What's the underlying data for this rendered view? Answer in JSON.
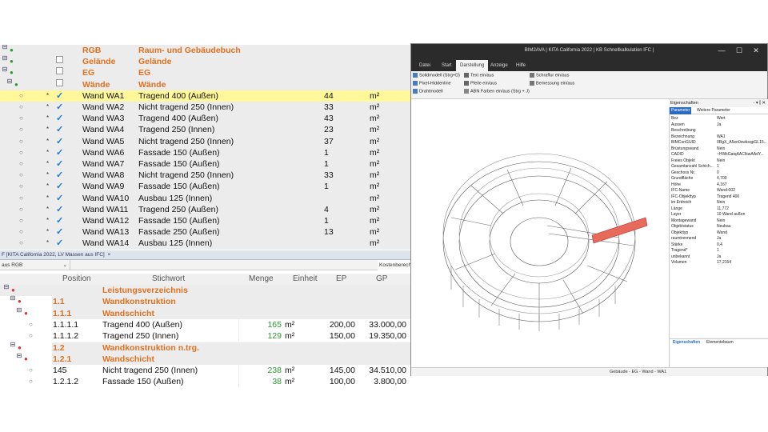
{
  "top_table": {
    "rows": [
      {
        "tree": "⊟",
        "dot": "●",
        "cb": "",
        "col1": "RGB",
        "col2": "Raum- und Gebäudebuch",
        "num": "",
        "unit": "",
        "style": "orange-gray"
      },
      {
        "tree": "⊟",
        "dot": "●",
        "cb": "□",
        "col1": "Gelände",
        "col2": "Gelände",
        "num": "",
        "unit": "",
        "style": "orange-gray"
      },
      {
        "tree": "⊟",
        "dot": "●",
        "cb": "□",
        "col1": "EG",
        "col2": "EG",
        "num": "",
        "unit": "",
        "style": "orange-gray"
      },
      {
        "tree": "⊟",
        "dot": "●",
        "cb": "□",
        "col1": "Wände",
        "col2": "Wände",
        "num": "",
        "unit": "",
        "style": "orange-gray"
      },
      {
        "dot": "○",
        "star": "*",
        "cb": "✓",
        "col1": "Wand WA1",
        "col2": "Tragend 400 (Außen)",
        "num": "44",
        "unit": "m²",
        "style": "yellow"
      },
      {
        "dot": "○",
        "star": "*",
        "cb": "✓",
        "col1": "Wand WA2",
        "col2": "Nicht tragend 250 (Innen)",
        "num": "33",
        "unit": "m²",
        "style": "gray"
      },
      {
        "dot": "○",
        "star": "*",
        "cb": "✓",
        "col1": "Wand WA3",
        "col2": "Tragend 400 (Außen)",
        "num": "43",
        "unit": "m²",
        "style": "gray"
      },
      {
        "dot": "○",
        "star": "*",
        "cb": "✓",
        "col1": "Wand WA4",
        "col2": "Tragend 250 (Innen)",
        "num": "23",
        "unit": "m²",
        "style": "gray"
      },
      {
        "dot": "○",
        "star": "*",
        "cb": "✓",
        "col1": "Wand WA5",
        "col2": "Nicht tragend 250 (Innen)",
        "num": "37",
        "unit": "m²",
        "style": "gray"
      },
      {
        "dot": "○",
        "star": "*",
        "cb": "✓",
        "col1": "Wand WA6",
        "col2": "Fassade 150 (Außen)",
        "num": "1",
        "unit": "m²",
        "style": "gray"
      },
      {
        "dot": "○",
        "star": "*",
        "cb": "✓",
        "col1": "Wand WA7",
        "col2": "Fassade 150 (Außen)",
        "num": "1",
        "unit": "m²",
        "style": "gray"
      },
      {
        "dot": "○",
        "star": "*",
        "cb": "✓",
        "col1": "Wand WA8",
        "col2": "Nicht tragend 250 (Innen)",
        "num": "33",
        "unit": "m²",
        "style": "gray"
      },
      {
        "dot": "○",
        "star": "*",
        "cb": "✓",
        "col1": "Wand WA9",
        "col2": "Fassade 150 (Außen)",
        "num": "1",
        "unit": "m²",
        "style": "gray"
      },
      {
        "dot": "○",
        "star": "*",
        "cb": "✓",
        "col1": "Wand WA10",
        "col2": "Ausbau 125 (Innen)",
        "num": "",
        "unit": "m²",
        "style": "gray"
      },
      {
        "dot": "○",
        "star": "*",
        "cb": "✓",
        "col1": "Wand WA11",
        "col2": "Tragend 250 (Außen)",
        "num": "4",
        "unit": "m²",
        "style": "gray"
      },
      {
        "dot": "○",
        "star": "*",
        "cb": "✓",
        "col1": "Wand WA12",
        "col2": "Fassade 150 (Außen)",
        "num": "1",
        "unit": "m²",
        "style": "gray"
      },
      {
        "dot": "○",
        "star": "*",
        "cb": "✓",
        "col1": "Wand WA13",
        "col2": "Fassade 250 (Außen)",
        "num": "13",
        "unit": "m²",
        "style": "gray"
      },
      {
        "dot": "○",
        "star": "*",
        "cb": "✓",
        "col1": "Wand WA14",
        "col2": "Ausbau 125 (Innen)",
        "num": "",
        "unit": "m²",
        "style": "gray"
      }
    ]
  },
  "mid_bar": {
    "title": "F [KITA California 2022, LV Massen aus IFC]",
    "close": "×"
  },
  "mid_bar2": {
    "select": "aus RGB",
    "right": "Kostenberechi"
  },
  "bottom_table": {
    "headers": {
      "position": "Position",
      "stichwort": "Stichwort",
      "menge": "Menge",
      "einheit": "Einheit",
      "ep": "EP",
      "gp": "GP"
    },
    "rows": [
      {
        "tree": "⊟",
        "dot": "●",
        "pos": "",
        "text": "Leistungsverzeichnis",
        "menge": "",
        "unit": "",
        "ep": "",
        "gp": "",
        "style": "orange-gray"
      },
      {
        "tree": "⊟",
        "dot": "●",
        "pos": "1.1",
        "text": "Wandkonstruktion",
        "menge": "",
        "unit": "",
        "ep": "",
        "gp": "",
        "style": "orange"
      },
      {
        "tree": "⊟",
        "dot": "●",
        "pos": "1.1.1",
        "text": "Wandschicht",
        "menge": "",
        "unit": "",
        "ep": "",
        "gp": "",
        "style": "orange"
      },
      {
        "dot": "○",
        "pos": "1.1.1.1",
        "text": "Tragend 400 (Außen)",
        "menge": "165",
        "unit": "m²",
        "ep": "200,00",
        "gp": "33.000,00",
        "style": "plain"
      },
      {
        "dot": "○",
        "pos": "1.1.1.2",
        "text": "Tragend 250 (Innen)",
        "menge": "129",
        "unit": "m²",
        "ep": "150,00",
        "gp": "19.350,00",
        "style": "plain"
      },
      {
        "tree": "⊟",
        "dot": "●",
        "pos": "1.2",
        "text": "Wandkonstruktion n.trg.",
        "menge": "",
        "unit": "",
        "ep": "",
        "gp": "",
        "style": "orange"
      },
      {
        "tree": "⊟",
        "dot": "●",
        "pos": "1.2.1",
        "text": "Wandschicht",
        "menge": "",
        "unit": "",
        "ep": "",
        "gp": "",
        "style": "orange"
      },
      {
        "dot": "○",
        "pos": "145",
        "text": "Nicht tragend 250 (Innen)",
        "menge": "238",
        "unit": "m²",
        "ep": "145,00",
        "gp": "34.510,00",
        "style": "plain"
      },
      {
        "dot": "○",
        "pos": "1.2.1.2",
        "text": "Fassade 150 (Außen)",
        "menge": "38",
        "unit": "m²",
        "ep": "100,00",
        "gp": "3.800,00",
        "style": "plain"
      }
    ]
  },
  "window": {
    "title": "BIM2AVA | KITA California 2022 |  KB Schnellkalkulation IFC |",
    "controls": {
      "min": "—",
      "max": "☐",
      "close": "✕"
    },
    "tabs": [
      "Datei",
      "Start",
      "Darstellung",
      "Anzeige",
      "Hilfe"
    ],
    "active_tab": "Darstellung",
    "ribbon": {
      "col1": [
        "Solidmodell (Strg+D)",
        "Pixel-Hiddenline",
        "Drahtmodell"
      ],
      "col2": [
        "Text ein/aus",
        "Pfeile ein/aus",
        "ABN Farben ein/aus (Strg + J)"
      ],
      "col3": [
        "Schraffur ein/aus",
        "Bemessung ein/aus"
      ]
    },
    "props": {
      "title": "Eigenschaften",
      "title_controls": "- ▾ ⫿ ✕",
      "tabs": [
        "Parameter",
        "Weitere Parameter"
      ],
      "rows": [
        [
          "Bez",
          "Wert"
        ],
        [
          "Aussen",
          "Ja"
        ],
        [
          "Beschreibung",
          ""
        ],
        [
          "Bezeichnung",
          "WA1"
        ],
        [
          "BIMConGUID",
          "0RgX_A5en0swksqpGL15..."
        ],
        [
          "Brüstungswand",
          "Nein"
        ],
        [
          "CADID",
          "~HWkGatqAACIkwAAdY..."
        ],
        [
          "Freies Objekt",
          "Nein"
        ],
        [
          "Gesamtanzahl Schich...",
          "1"
        ],
        [
          "Geschoss Nr.",
          "0"
        ],
        [
          "Grundfläche",
          "4,709"
        ],
        [
          "Höhe",
          "4,167"
        ],
        [
          "IFC-Name",
          "Wand-002"
        ],
        [
          "IFC-Objekttyp",
          "Tragend 400"
        ],
        [
          "im Erdreich",
          "Nein"
        ],
        [
          "Länge",
          "11,772"
        ],
        [
          "Layer",
          "10 Wand außen"
        ],
        [
          "Montagewand",
          "Nein"
        ],
        [
          "Objektstatus",
          "Neubau"
        ],
        [
          "Objekttyp",
          "Wand"
        ],
        [
          "raumtrennend",
          "Ja"
        ],
        [
          "Stärke",
          "0,4"
        ],
        [
          "Tragend*",
          "1"
        ],
        [
          "unbekannt",
          "Ja"
        ],
        [
          "Volumen",
          "17,2154"
        ]
      ],
      "bottom_tabs": [
        "Eigenschaften",
        "Elementebaum"
      ]
    },
    "status": "Gebäude - EG - Wand - WA1"
  },
  "colors": {
    "orange": "#e07020",
    "check": "#1a7ad8",
    "green": "#2a9a2a",
    "highlight": "#fff79a",
    "selected_wall": "#e86a5a"
  }
}
